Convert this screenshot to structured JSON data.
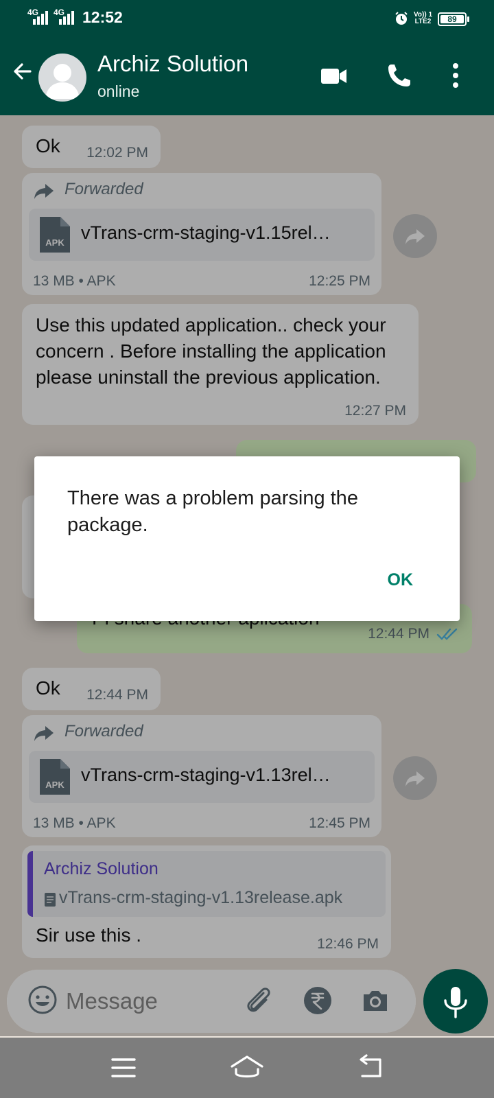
{
  "status_bar": {
    "network_1": "4G",
    "network_2": "4G",
    "time": "12:52",
    "volte_line1": "Vo)) 1",
    "volte_line2": "LTE2",
    "battery": "89"
  },
  "header": {
    "contact_name": "Archiz Solution",
    "contact_status": "online"
  },
  "messages": [
    {
      "type": "text",
      "text": "Ok",
      "time": "12:02 PM"
    },
    {
      "type": "file",
      "forwarded_label": "Forwarded",
      "file_icon_text": "APK",
      "file_name": "vTrans-crm-staging-v1.15rel…",
      "meta": "13 MB • APK",
      "time": "12:25 PM"
    },
    {
      "type": "text",
      "text": "Use this updated application..  check your concern . Before installing the application please uninstall the previous application.",
      "time": "12:27 PM"
    },
    {
      "type": "outgoing_text",
      "text": "Pl share another aplication",
      "time": "12:44 PM"
    },
    {
      "type": "text",
      "text": "Ok",
      "time": "12:44 PM"
    },
    {
      "type": "file",
      "forwarded_label": "Forwarded",
      "file_icon_text": "APK",
      "file_name": "vTrans-crm-staging-v1.13rel…",
      "meta": "13 MB • APK",
      "time": "12:45 PM"
    },
    {
      "type": "reply",
      "quoted_name": "Archiz Solution",
      "quoted_file": "vTrans-crm-staging-v1.13release.apk",
      "text": "Sir use this .",
      "time": "12:46 PM"
    }
  ],
  "dialog": {
    "message": "There was a problem parsing the package.",
    "ok_label": "OK"
  },
  "input_bar": {
    "placeholder": "Message"
  },
  "colors": {
    "header": "#00483d",
    "accent": "#008069",
    "read_ticks": "#53bdeb",
    "outgoing_bubble": "#dcf8c6"
  }
}
